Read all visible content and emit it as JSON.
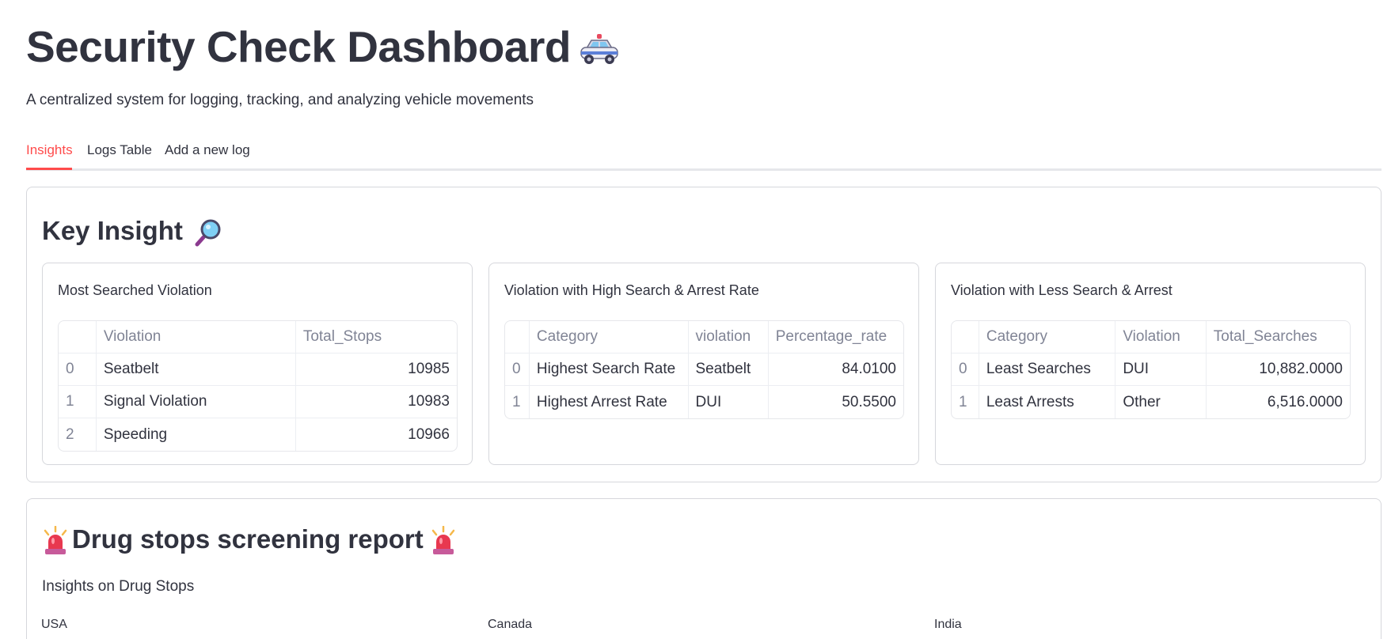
{
  "header": {
    "title": "Security Check Dashboard",
    "subtitle": "A centralized system for logging, tracking, and analyzing vehicle movements"
  },
  "tabs": [
    {
      "label": "Insights",
      "active": true
    },
    {
      "label": "Logs Table",
      "active": false
    },
    {
      "label": "Add a new log",
      "active": false
    }
  ],
  "key_insight": {
    "title": "Key Insight",
    "most_searched": {
      "title": "Most Searched Violation",
      "columns": [
        "",
        "Violation",
        "Total_Stops"
      ],
      "rows": [
        [
          "0",
          "Seatbelt",
          "10985"
        ],
        [
          "1",
          "Signal Violation",
          "10983"
        ],
        [
          "2",
          "Speeding",
          "10966"
        ]
      ]
    },
    "high_rate": {
      "title": "Violation with High Search & Arrest Rate",
      "columns": [
        "",
        "Category",
        "violation",
        "Percentage_rate"
      ],
      "rows": [
        [
          "0",
          "Highest Search Rate",
          "Seatbelt",
          "84.0100"
        ],
        [
          "1",
          "Highest Arrest Rate",
          "DUI",
          "50.5500"
        ]
      ]
    },
    "less_search": {
      "title": "Violation with Less Search & Arrest",
      "columns": [
        "",
        "Category",
        "Violation",
        "Total_Searches"
      ],
      "rows": [
        [
          "0",
          "Least Searches",
          "DUI",
          "10,882.0000"
        ],
        [
          "1",
          "Least Arrests",
          "Other",
          "6,516.0000"
        ]
      ]
    }
  },
  "drug_report": {
    "title": "Drug stops screening report",
    "subtitle": "Insights on Drug Stops",
    "countries": [
      "USA",
      "Canada",
      "India"
    ]
  },
  "colors": {
    "accent": "#ff4b4b",
    "text": "#31333f",
    "muted": "#808495",
    "border": "#d6d7dc"
  },
  "icons": [
    "police-car-icon",
    "magnifying-glass-icon",
    "siren-icon"
  ]
}
